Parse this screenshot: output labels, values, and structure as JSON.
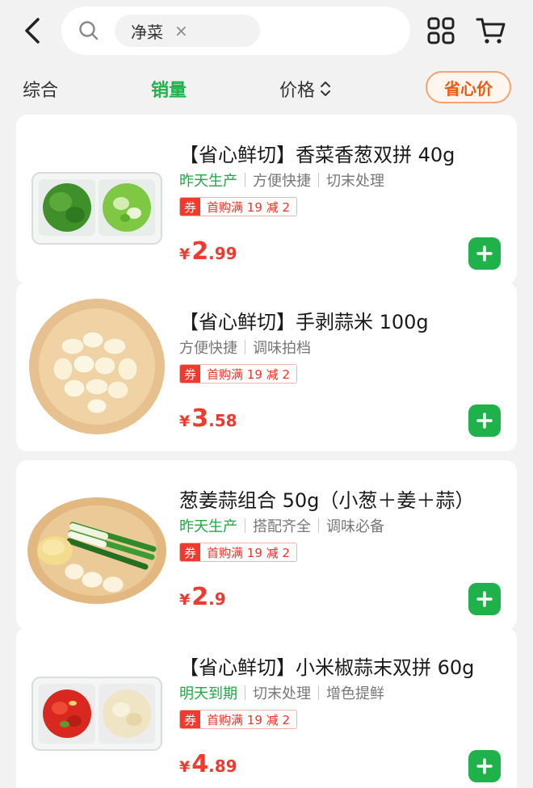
{
  "search": {
    "chip_label": "净菜",
    "chip_clear": "×"
  },
  "sort": {
    "comprehensive": "综合",
    "sales": "销量",
    "price": "价格",
    "saver": "省心价"
  },
  "products": [
    {
      "title": "【省心鲜切】香菜香葱双拼 40g",
      "tag_green": "昨天生产",
      "tags": [
        "方便快捷",
        "切末处理"
      ],
      "coupon_mark": "券",
      "coupon_text": "首购满 19 减 2",
      "price_symbol": "¥",
      "price_int": "2",
      "price_dec": ".99"
    },
    {
      "title": "【省心鲜切】手剥蒜米 100g",
      "tag_green": "",
      "tags": [
        "方便快捷",
        "调味拍档"
      ],
      "coupon_mark": "券",
      "coupon_text": "首购满 19 减 2",
      "price_symbol": "¥",
      "price_int": "3",
      "price_dec": ".58"
    },
    {
      "title": "葱姜蒜组合 50g（小葱＋姜＋蒜）",
      "tag_green": "昨天生产",
      "tags": [
        "搭配齐全",
        "调味必备"
      ],
      "coupon_mark": "券",
      "coupon_text": "首购满 19 减 2",
      "price_symbol": "¥",
      "price_int": "2",
      "price_dec": ".9"
    },
    {
      "title": "【省心鲜切】小米椒蒜末双拼 60g",
      "tag_green": "明天到期",
      "tags": [
        "切末处理",
        "增色提鲜"
      ],
      "coupon_mark": "券",
      "coupon_text": "首购满 19 减 2",
      "price_symbol": "¥",
      "price_int": "4",
      "price_dec": ".89"
    }
  ],
  "colors": {
    "accent_green": "#1fb24a",
    "price_red": "#f03a2e",
    "saver_orange": "#ee5a12"
  },
  "icons": {
    "back": "chevron-left-icon",
    "search": "search-icon",
    "grid": "grid-icon",
    "cart": "cart-icon",
    "sort": "sort-updown-icon",
    "add": "plus-icon"
  }
}
